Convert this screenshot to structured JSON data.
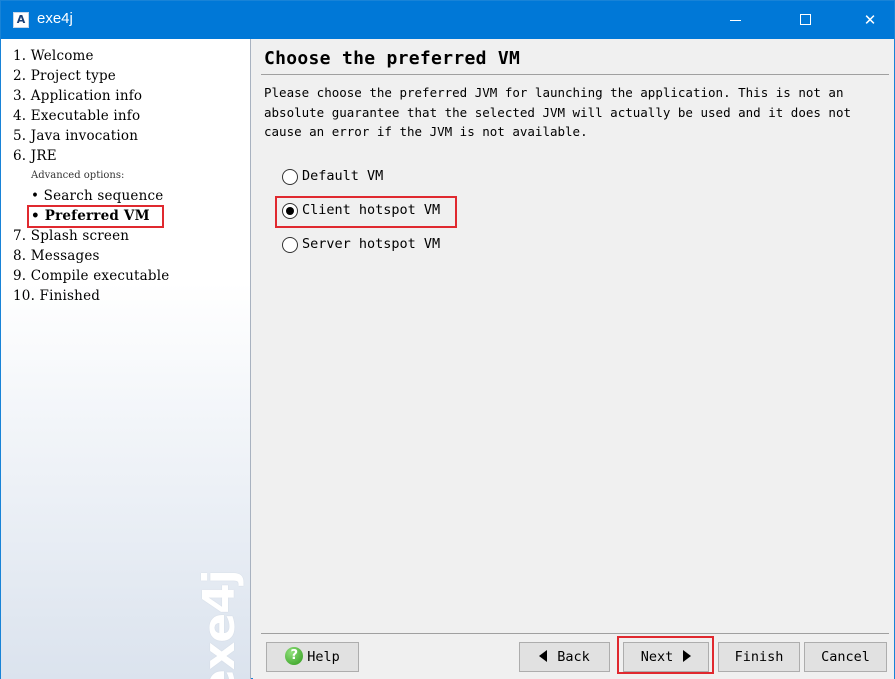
{
  "window": {
    "title": "exe4j",
    "app_icon_glyph": "A",
    "controls": {
      "minimize": "minimize-icon",
      "maximize": "maximize-icon",
      "close": "✕"
    }
  },
  "nav": {
    "items": [
      {
        "label": "1.  Welcome"
      },
      {
        "label": "2.  Project type"
      },
      {
        "label": "3.  Application info"
      },
      {
        "label": "4.  Executable info"
      },
      {
        "label": "5.  Java invocation"
      },
      {
        "label": "6.  JRE"
      }
    ],
    "advanced_header": "Advanced options:",
    "sub_items": [
      {
        "label": "• Search sequence"
      },
      {
        "label": "• Preferred VM"
      }
    ],
    "items_after": [
      {
        "label": "7.  Splash screen"
      },
      {
        "label": "8.  Messages"
      },
      {
        "label": "9.  Compile executable"
      },
      {
        "label": "10.  Finished"
      }
    ],
    "watermark": "exe4j"
  },
  "main": {
    "title": "Choose the preferred VM",
    "description": "Please choose the preferred JVM for launching the application. This is not an absolute guarantee that the selected JVM will actually be used and it does not cause an error if the JVM is not available.",
    "options": [
      {
        "label": "Default VM",
        "checked": false
      },
      {
        "label": "Client hotspot VM",
        "checked": true
      },
      {
        "label": "Server hotspot VM",
        "checked": false
      }
    ]
  },
  "buttons": {
    "help": "Help",
    "back": "Back",
    "next": "Next",
    "finish": "Finish",
    "cancel": "Cancel"
  },
  "colors": {
    "titlebar": "#0078d7",
    "highlight": "#e0292f"
  }
}
